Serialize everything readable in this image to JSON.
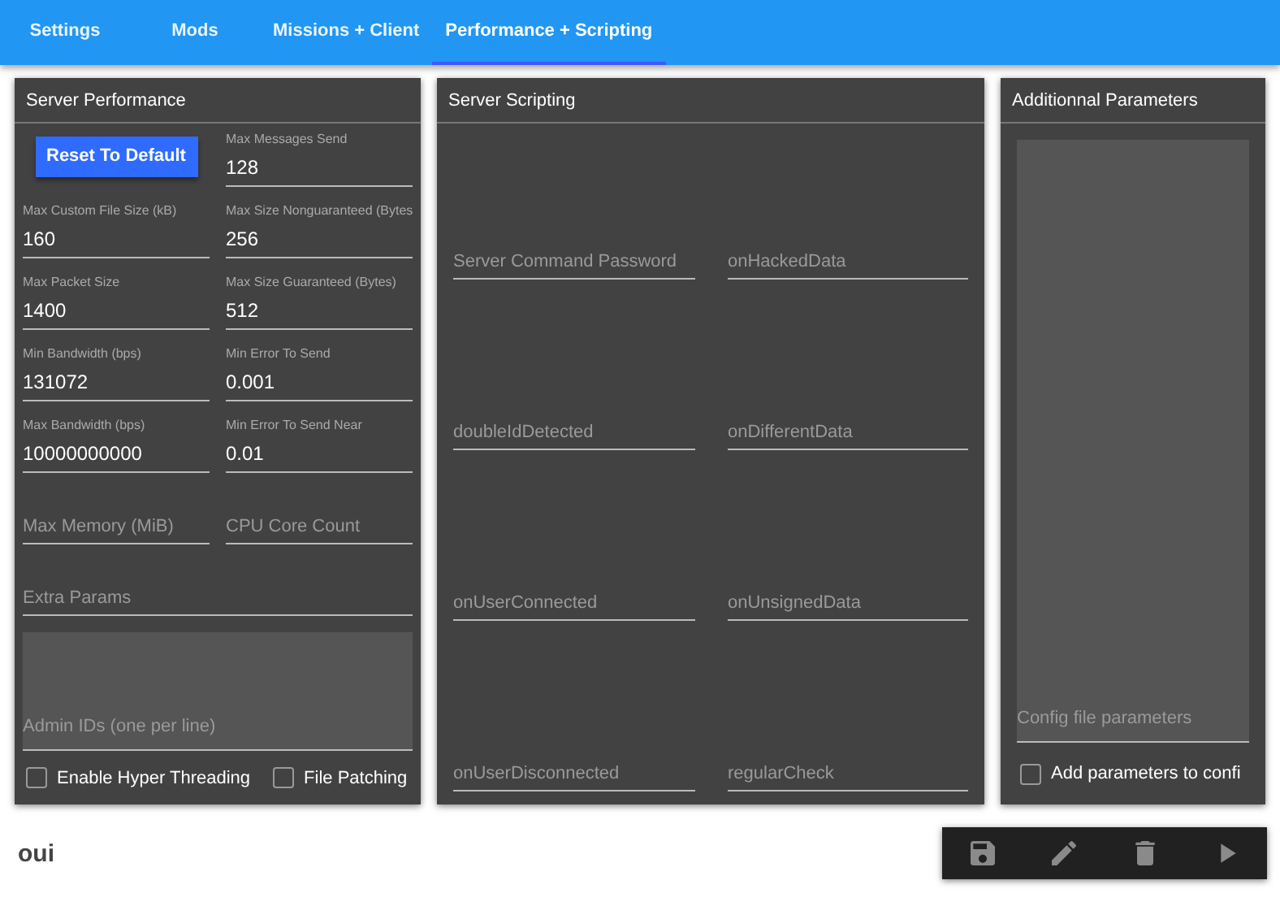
{
  "tabs": [
    {
      "label": "Settings",
      "selected": false
    },
    {
      "label": "Mods",
      "selected": false
    },
    {
      "label": "Missions + Client",
      "selected": false
    },
    {
      "label": "Performance + Scripting",
      "selected": true
    }
  ],
  "server_performance": {
    "title": "Server Performance",
    "reset_button": "Reset To Default",
    "fields": [
      {
        "kind": "filled",
        "label": "Max Messages Send",
        "value": "128"
      },
      {
        "kind": "filled",
        "label": "Max Custom File Size (kB)",
        "value": "160"
      },
      {
        "kind": "filled",
        "label": "Max Size Nonguaranteed (Bytes",
        "value": "256"
      },
      {
        "kind": "filled",
        "label": "Max Packet Size",
        "value": "1400"
      },
      {
        "kind": "filled",
        "label": "Max Size Guaranteed (Bytes)",
        "value": "512"
      },
      {
        "kind": "filled",
        "label": "Min Bandwidth (bps)",
        "value": "131072"
      },
      {
        "kind": "filled",
        "label": "Min Error To Send",
        "value": "0.001"
      },
      {
        "kind": "filled",
        "label": "Max Bandwidth (bps)",
        "value": "10000000000"
      },
      {
        "kind": "filled",
        "label": "Min Error To Send Near",
        "value": "0.01"
      },
      {
        "kind": "empty",
        "placeholder": "Max Memory (MiB)"
      },
      {
        "kind": "empty",
        "placeholder": "CPU Core Count"
      }
    ],
    "extra_params": {
      "placeholder": "Extra Params"
    },
    "admin_ids": {
      "placeholder": "Admin IDs (one per line)"
    },
    "checkboxes": [
      {
        "label": "Enable Hyper Threading",
        "checked": false
      },
      {
        "label": "File Patching",
        "checked": false
      }
    ]
  },
  "server_scripting": {
    "title": "Server Scripting",
    "fields": [
      {
        "placeholder": "Server Command Password"
      },
      {
        "placeholder": "onHackedData"
      },
      {
        "placeholder": "doubleIdDetected"
      },
      {
        "placeholder": "onDifferentData"
      },
      {
        "placeholder": "onUserConnected"
      },
      {
        "placeholder": "onUnsignedData"
      },
      {
        "placeholder": "onUserDisconnected"
      },
      {
        "placeholder": "regularCheck"
      }
    ]
  },
  "additional_parameters": {
    "title": "Additionnal Parameters",
    "config": {
      "placeholder": "Config file parameters"
    },
    "checkbox": {
      "label": "Add parameters to confi",
      "checked": false
    }
  },
  "footer": {
    "title": "oui",
    "actions": [
      {
        "kind": "save"
      },
      {
        "kind": "edit"
      },
      {
        "kind": "delete"
      },
      {
        "kind": "play"
      }
    ]
  }
}
